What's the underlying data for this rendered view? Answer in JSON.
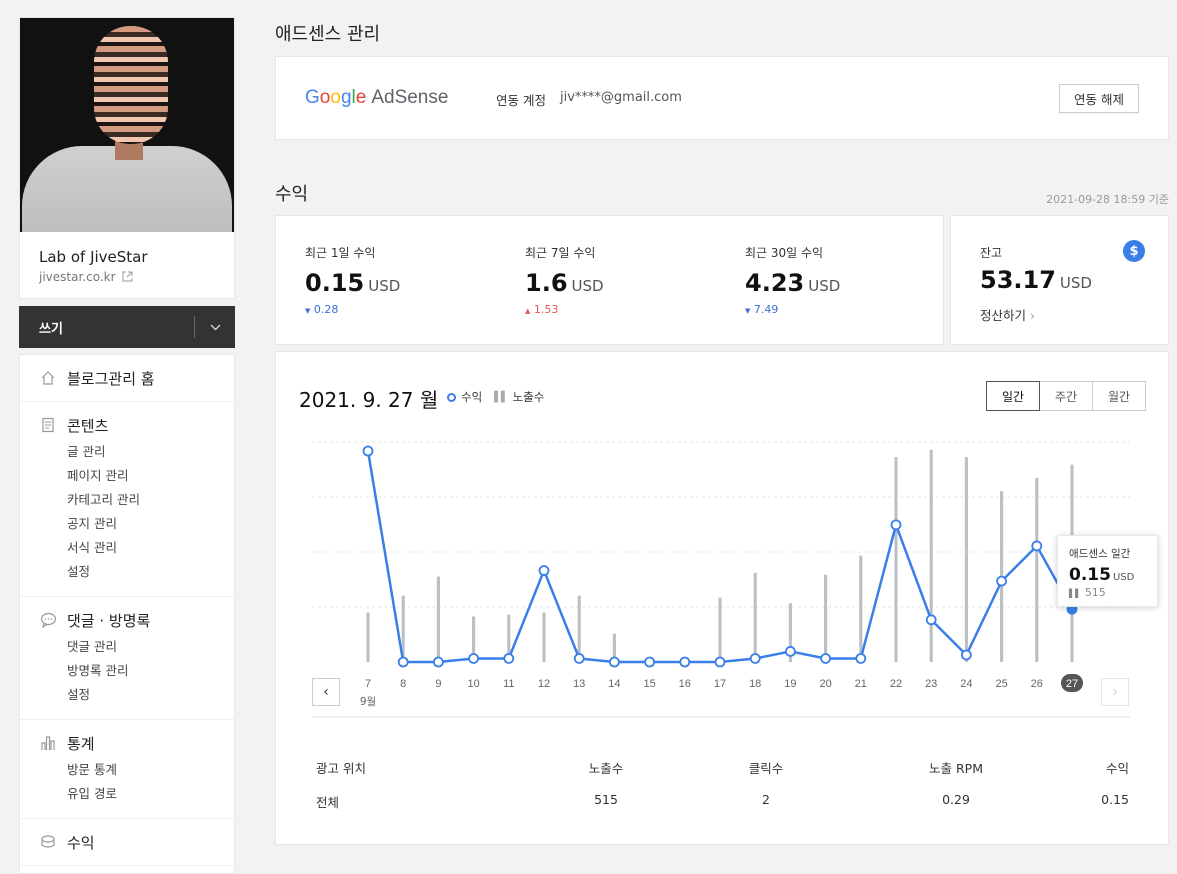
{
  "sidebar": {
    "blog_name": "Lab of JiveStar",
    "blog_url": "jivestar.co.kr",
    "write_label": "쓰기",
    "menu": [
      {
        "title": "블로그관리 홈",
        "icon": "home-icon",
        "items": []
      },
      {
        "title": "콘텐츠",
        "icon": "document-icon",
        "items": [
          "글 관리",
          "페이지 관리",
          "카테고리 관리",
          "공지 관리",
          "서식 관리",
          "설정"
        ]
      },
      {
        "title": "댓글 · 방명록",
        "icon": "comment-icon",
        "items": [
          "댓글 관리",
          "방명록 관리",
          "설정"
        ]
      },
      {
        "title": "통계",
        "icon": "bar-chart-icon",
        "items": [
          "방문 통계",
          "유입 경로"
        ]
      },
      {
        "title": "수익",
        "icon": "coin-icon",
        "items": []
      }
    ]
  },
  "adsense": {
    "title": "애드센스 관리",
    "account_label": "연동 계정",
    "account_value": "jiv****@gmail.com",
    "unlink_label": "연동 해제",
    "logo_google": "Google",
    "logo_product": "AdSense"
  },
  "revenue": {
    "title": "수익",
    "as_of": "2021-09-28 18:59 기준",
    "items": [
      {
        "label": "최근 1일 수익",
        "value": "0.15",
        "unit": "USD",
        "change": "0.28",
        "direction": "down"
      },
      {
        "label": "최근 7일 수익",
        "value": "1.6",
        "unit": "USD",
        "change": "1.53",
        "direction": "up"
      },
      {
        "label": "최근 30일 수익",
        "value": "4.23",
        "unit": "USD",
        "change": "7.49",
        "direction": "down"
      }
    ],
    "balance": {
      "label": "잔고",
      "value": "53.17",
      "unit": "USD",
      "settle_label": "정산하기"
    }
  },
  "chart_panel": {
    "date_title": "2021. 9. 27 월",
    "legend_revenue": "수익",
    "legend_impressions": "노출수",
    "tabs": [
      {
        "label": "일간",
        "active": true
      },
      {
        "label": "주간",
        "active": false
      },
      {
        "label": "월간",
        "active": false
      }
    ],
    "tooltip": {
      "title": "애드센스 일간",
      "value": "0.15",
      "unit": "USD",
      "impressions": "515"
    },
    "month_label": "9월",
    "colors": {
      "line": "#3a7ee8",
      "bars": "#b9bdc4",
      "selected": "#555555"
    }
  },
  "chart_data": {
    "type": "line",
    "x": [
      "7",
      "8",
      "9",
      "10",
      "11",
      "12",
      "13",
      "14",
      "15",
      "16",
      "17",
      "18",
      "19",
      "20",
      "21",
      "22",
      "23",
      "24",
      "25",
      "26",
      "27"
    ],
    "series": [
      {
        "name": "수익",
        "values": [
          0.6,
          0.0,
          0.0,
          0.01,
          0.01,
          0.26,
          0.01,
          0.0,
          0.0,
          0.0,
          0.0,
          0.01,
          0.03,
          0.01,
          0.01,
          0.39,
          0.12,
          0.02,
          0.23,
          0.33,
          0.15
        ]
      },
      {
        "name": "노출수",
        "values": [
          130,
          175,
          225,
          120,
          125,
          130,
          175,
          75,
          0,
          0,
          170,
          235,
          155,
          230,
          280,
          540,
          560,
          540,
          450,
          485,
          520
        ]
      }
    ],
    "selected": "27"
  },
  "table": {
    "headers": [
      "광고 위치",
      "노출수",
      "클릭수",
      "노출 RPM",
      "수익"
    ],
    "rows": [
      [
        "전체",
        "515",
        "2",
        "0.29",
        "0.15"
      ]
    ]
  }
}
